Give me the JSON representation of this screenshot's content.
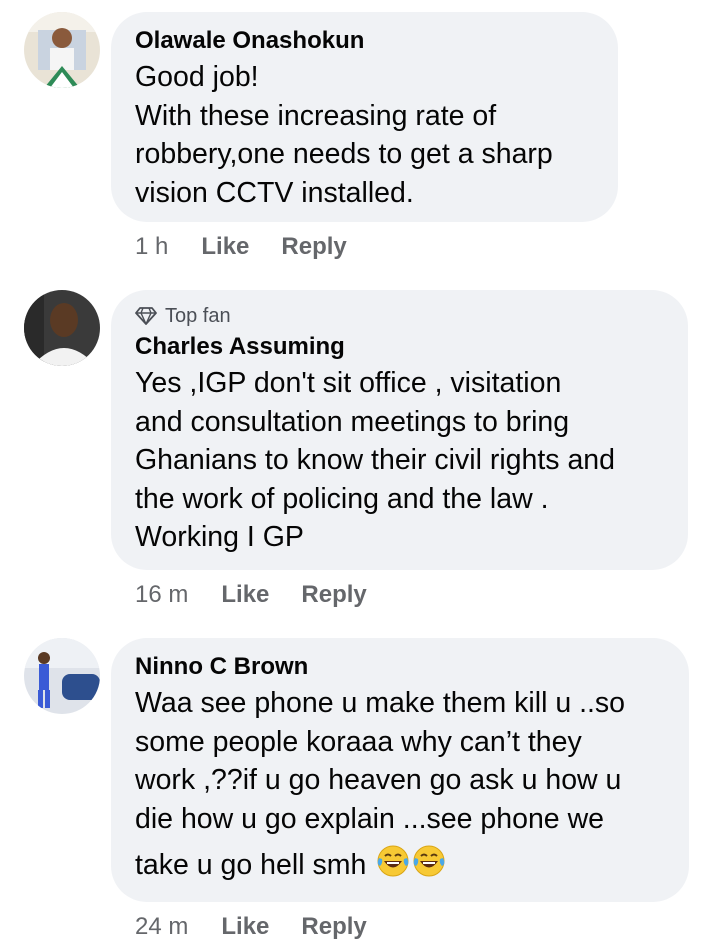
{
  "comments": [
    {
      "author": "Olawale Onashokun",
      "badge": "",
      "lines": [
        "Good job!",
        "With these increasing rate of",
        "robbery,one needs to get a sharp",
        "vision CCTV installed."
      ],
      "time": "1 h",
      "like_label": "Like",
      "reply_label": "Reply"
    },
    {
      "author": "Charles Assuming",
      "badge": "Top fan",
      "lines": [
        "Yes ,IGP don't sit office  , visitation",
        "and consultation meetings to bring",
        "Ghanians to know their civil rights and",
        "the work of policing and the law .",
        "Working I GP"
      ],
      "time": "16 m",
      "like_label": "Like",
      "reply_label": "Reply"
    },
    {
      "author": "Ninno C Brown",
      "badge": "",
      "lines": [
        "Waa see phone u make them kill u ..so",
        "some people koraaa why can’t they",
        "work ,??if u go heaven go ask u how u",
        "die how u go explain ...see phone we",
        "take u go hell smh"
      ],
      "emoji": [
        "laughing-tears-emoji",
        "laughing-tears-emoji"
      ],
      "time": "24 m",
      "like_label": "Like",
      "reply_label": "Reply"
    }
  ],
  "colors": {
    "bubble": "#f0f2f5",
    "meta_text": "#65676b",
    "body_text": "#050505"
  }
}
